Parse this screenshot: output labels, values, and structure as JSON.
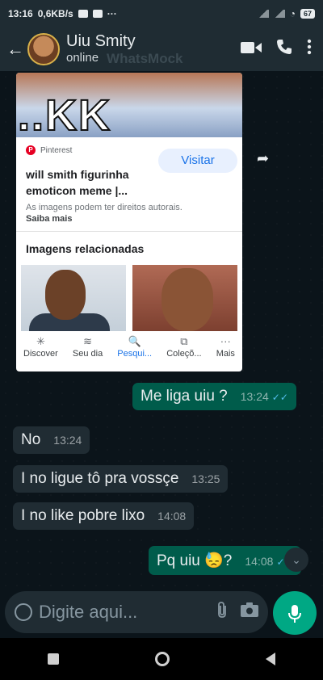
{
  "status_bar": {
    "time": "13:16",
    "speed": "0,6KB/s",
    "extra": "···",
    "battery": "67"
  },
  "header": {
    "back_icon": "arrow-left-icon",
    "contact_name": "Uiu Smity",
    "status": "online",
    "watermark": "WhatsMock",
    "icons": [
      "video-call-icon",
      "phone-icon",
      "more-vert-icon"
    ]
  },
  "image_card": {
    "banner_text": "..KK",
    "source": "Pinterest",
    "visit_label": "Visitar",
    "title": "will smith figurinha emoticon meme |...",
    "rights_text": "As imagens podem ter direitos autorais.",
    "learn_more": "Saiba mais",
    "related_title": "Imagens relacionadas",
    "nav": [
      {
        "label": "Discover",
        "icon": "✳",
        "active": false
      },
      {
        "label": "Seu dia",
        "icon": "≋",
        "active": false
      },
      {
        "label": "Pesqui...",
        "icon": "🔍",
        "active": true
      },
      {
        "label": "Coleçõ...",
        "icon": "⧉",
        "active": false
      },
      {
        "label": "Mais",
        "icon": "···",
        "active": false
      }
    ]
  },
  "messages": [
    {
      "direction": "out",
      "text": "Me liga uiu ?",
      "time": "13:24",
      "ticks": "✓✓"
    },
    {
      "direction": "in",
      "text": "No",
      "time": "13:24"
    },
    {
      "direction": "in",
      "text": "I no ligue tô pra vossçe",
      "time": "13:25"
    },
    {
      "direction": "in",
      "text": "I no like pobre lixo",
      "time": "14:08"
    },
    {
      "direction": "out",
      "text": "Pq uiu 😓?",
      "time": "14:08",
      "ticks": "✓✓"
    }
  ],
  "composer": {
    "placeholder": "Digite aqui..."
  },
  "colors": {
    "outgoing_bubble": "#005c4b",
    "incoming_bubble": "#202c33",
    "accent": "#00a884"
  }
}
